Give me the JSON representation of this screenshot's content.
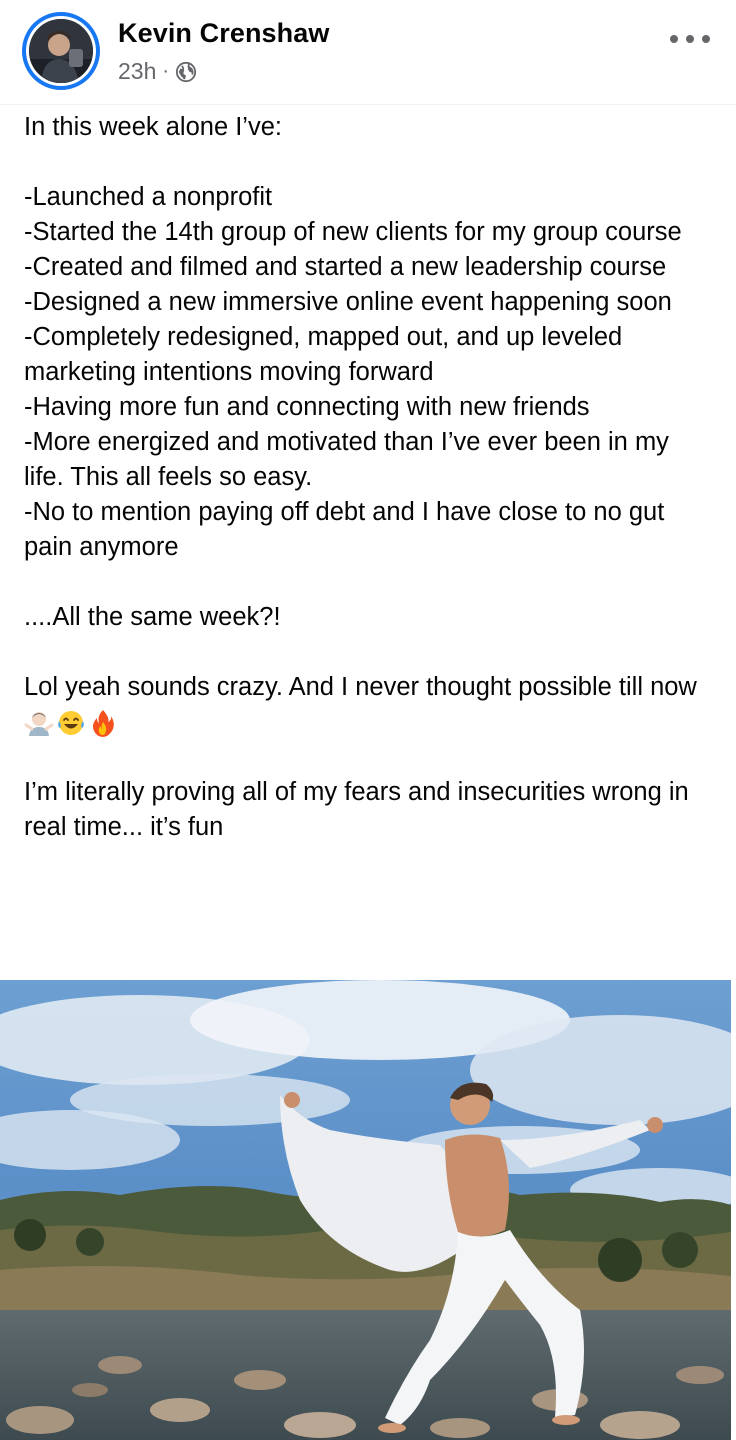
{
  "author": {
    "name": "Kevin Crenshaw",
    "time": "23h",
    "separator": "·",
    "audience_icon": "globe-icon"
  },
  "menu": {
    "icon": "more-options-icon"
  },
  "post": {
    "lines": [
      "In this week alone I’ve:",
      "",
      "-Launched a nonprofit",
      "-Started the 14th group of new clients for my group course",
      "-Created and filmed and started a new leadership course",
      "-Designed a new immersive online event happening soon",
      "-Completely redesigned, mapped out, and up leveled marketing intentions moving forward",
      "-Having more fun and connecting with new friends",
      "-More energized and motivated than I’ve ever been in my life. This all feels so easy.",
      "-No to mention paying off debt and I have close to no gut pain anymore",
      "",
      "....All the same week?!",
      "",
      "Lol yeah sounds crazy. And I never thought possible till now",
      "",
      "I’m literally proving all of my fears and insecurities wrong in real time... it’s fun"
    ],
    "emojis": [
      "man-shrugging-emoji",
      "laughing-tears-emoji",
      "fire-emoji"
    ]
  },
  "photo": {
    "subject": "man-in-white-shirt-posing-on-rocks-photo"
  },
  "colors": {
    "accent": "#1877f2",
    "text": "#050505",
    "secondary": "#65676b",
    "sky": "#4f86c6"
  }
}
